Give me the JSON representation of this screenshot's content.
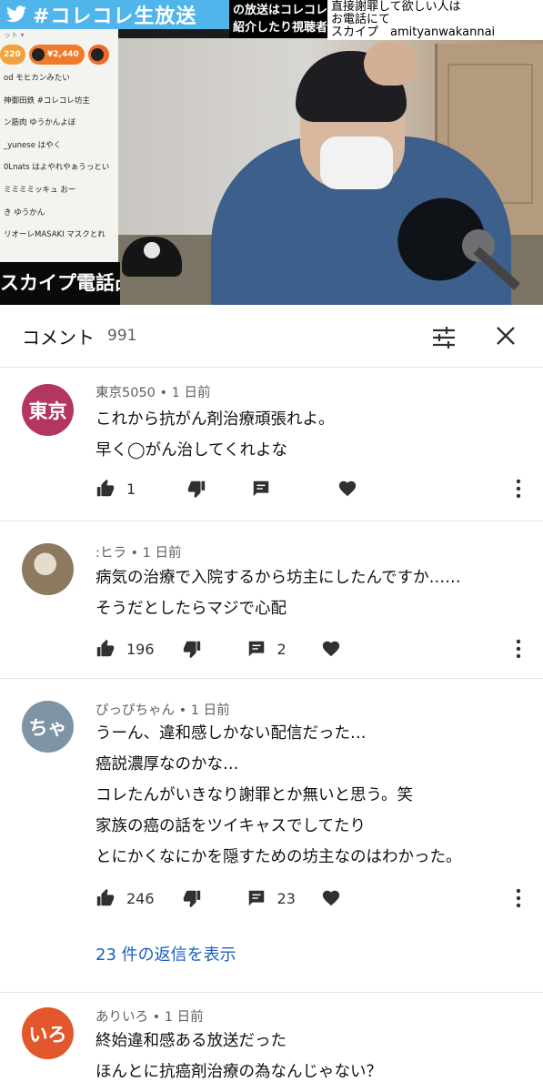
{
  "video": {
    "banner_text": "#コレコレ生放送",
    "overlay_black_lines": [
      "の放送はコレコレ",
      "紹介したり視聴者"
    ],
    "overlay_white_lines": [
      "直接謝罪して欲しい人は",
      "お電話にて",
      "スカイプ　amityanwakannai"
    ],
    "chat_top": "ット ▾",
    "gifts": [
      {
        "amount": "220"
      },
      {
        "amount": "¥2,440"
      },
      {
        "amount": ""
      }
    ],
    "chat_lines": [
      "od  モヒカンみたい",
      "神御田鉄  #コレコレ坊主",
      "ン筋肉  ゆうかんよぼ",
      "_yunese  はやく",
      "0Lnats  はよやれやぁうっとい",
      "ミミミミッキュ  おー",
      "き  ゆうかん",
      "リオーレMASAKI  マスクとれ"
    ],
    "skype_banner": "スカイプ電話凸"
  },
  "header": {
    "title": "コメント",
    "count": "991"
  },
  "comments": [
    {
      "avatar_text": "東京",
      "avatar_color": "#b3365f",
      "author": "東京5050 • 1 日前",
      "lines": [
        "これから抗がん剤治療頑張れよ。",
        "早く◯がん治してくれよな"
      ],
      "likes": "1",
      "replies": ""
    },
    {
      "avatar_text": "",
      "avatar_color": "#7a6a55",
      "author": ":ヒラ • 1 日前",
      "lines": [
        "病気の治療で入院するから坊主にしたんですか……",
        "そうだとしたらマジで心配"
      ],
      "likes": "196",
      "replies": "2"
    },
    {
      "avatar_text": "ちゃ",
      "avatar_color": "#7d93a6",
      "author": "ぴっぴちゃん • 1 日前",
      "lines": [
        "うーん、違和感しかない配信だった…",
        "癌説濃厚なのかな…",
        "コレたんがいきなり謝罪とか無いと思う。笑",
        "家族の癌の話をツイキャスでしてたり",
        "とにかくなにかを隠すための坊主なのはわかった。"
      ],
      "likes": "246",
      "replies": "23",
      "reply_link": "23 件の返信を表示"
    },
    {
      "avatar_text": "いろ",
      "avatar_color": "#e2572b",
      "author": "ありいろ • 1 日前",
      "lines": [
        "終始違和感ある放送だった",
        "ほんとに抗癌剤治療の為なんじゃない？"
      ]
    }
  ]
}
